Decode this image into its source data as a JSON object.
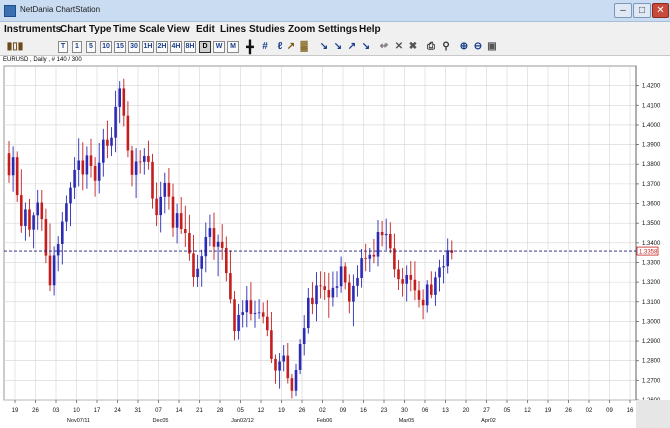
{
  "window": {
    "title": "NetDania ChartStation"
  },
  "menu": [
    "Instruments",
    "Chart Type",
    "Time Scale",
    "View",
    "Edit",
    "Lines",
    "Studies",
    "Zoom",
    "Settings",
    "Help"
  ],
  "toolbar": {
    "timeframes": [
      {
        "label": "T",
        "selected": false
      },
      {
        "label": "1",
        "selected": false
      },
      {
        "label": "5",
        "selected": false
      },
      {
        "label": "10",
        "selected": false
      },
      {
        "label": "15",
        "selected": false
      },
      {
        "label": "30",
        "selected": false
      },
      {
        "label": "1H",
        "selected": false
      },
      {
        "label": "2H",
        "selected": false
      },
      {
        "label": "4H",
        "selected": false
      },
      {
        "label": "8H",
        "selected": false
      },
      {
        "label": "D",
        "selected": true
      },
      {
        "label": "W",
        "selected": false
      },
      {
        "label": "M",
        "selected": false
      }
    ],
    "icons": [
      "crosshair-icon",
      "grid-icon",
      "fibonacci-icon",
      "volume-bars-icon",
      "line-tool-icon",
      "line-tool-icon",
      "line-tool-icon",
      "line-tool-icon",
      "line-tool-icon",
      "line-tool-icon",
      "line-tool-icon",
      "eraser-icon",
      "delete-icon",
      "delete-all-icon",
      "print-icon",
      "find-icon",
      "zoom-in-icon",
      "zoom-out-icon",
      "window-icon"
    ]
  },
  "chart": {
    "instrument_label": "EURUSD , Daily , # 140 / 300",
    "current_price_label": "1.3358",
    "colors": {
      "up": "#2b2bb5",
      "down": "#c41e1e",
      "grid": "#d4d4d4",
      "current_line": "#1a1a7a"
    }
  },
  "chart_data": {
    "type": "candlestick",
    "title": "",
    "ylim": [
      1.26,
      1.43
    ],
    "y_ticks": [
      "1.2600",
      "1.2700",
      "1.2800",
      "1.2900",
      "1.3000",
      "1.3100",
      "1.3200",
      "1.3300",
      "1.3400",
      "1.3500",
      "1.3600",
      "1.3700",
      "1.3800",
      "1.3900",
      "1.4000",
      "1.4100",
      "1.4200"
    ],
    "x_ticks": [
      "19",
      "26",
      "03",
      "10",
      "17",
      "24",
      "31",
      "07",
      "14",
      "21",
      "28",
      "05",
      "12",
      "19",
      "26",
      "02",
      "09",
      "16",
      "23",
      "30",
      "06",
      "13",
      "20",
      "27",
      "05",
      "12",
      "19",
      "26",
      "02",
      "09",
      "16"
    ],
    "x_month_labels": [
      {
        "label": "Nov07/11",
        "tick": 3
      },
      {
        "label": "Dec05",
        "tick": 7
      },
      {
        "label": "Jan02/12",
        "tick": 11
      },
      {
        "label": "Feb06",
        "tick": 15
      },
      {
        "label": "Mar05",
        "tick": 19
      },
      {
        "label": "Apr02",
        "tick": 23
      }
    ],
    "current_price": 1.3358,
    "candles": [
      [
        1.3856,
        1.3918,
        1.3705,
        1.3744
      ],
      [
        1.3744,
        1.3891,
        1.366,
        1.3836
      ],
      [
        1.3836,
        1.3865,
        1.3608,
        1.3643
      ],
      [
        1.3643,
        1.3774,
        1.3451,
        1.3486
      ],
      [
        1.3486,
        1.3605,
        1.3411,
        1.357
      ],
      [
        1.357,
        1.3624,
        1.3431,
        1.3467
      ],
      [
        1.3467,
        1.3555,
        1.3372,
        1.354
      ],
      [
        1.354,
        1.3669,
        1.3466,
        1.3605
      ],
      [
        1.3605,
        1.3669,
        1.3461,
        1.3521
      ],
      [
        1.3521,
        1.3574,
        1.3297,
        1.3335
      ],
      [
        1.3335,
        1.3498,
        1.3154,
        1.3184
      ],
      [
        1.3184,
        1.3382,
        1.3132,
        1.3336
      ],
      [
        1.3336,
        1.3434,
        1.3255,
        1.3394
      ],
      [
        1.3394,
        1.3557,
        1.329,
        1.3508
      ],
      [
        1.3508,
        1.3641,
        1.346,
        1.3601
      ],
      [
        1.3601,
        1.3709,
        1.3485,
        1.3681
      ],
      [
        1.3681,
        1.3836,
        1.3623,
        1.3771
      ],
      [
        1.3771,
        1.3932,
        1.3687,
        1.3819
      ],
      [
        1.3819,
        1.3912,
        1.3667,
        1.3748
      ],
      [
        1.3748,
        1.3891,
        1.3675,
        1.3845
      ],
      [
        1.3845,
        1.393,
        1.3732,
        1.3791
      ],
      [
        1.3791,
        1.3836,
        1.3635,
        1.3716
      ],
      [
        1.3716,
        1.3908,
        1.3651,
        1.3808
      ],
      [
        1.3808,
        1.398,
        1.3737,
        1.3925
      ],
      [
        1.3925,
        1.4022,
        1.3831,
        1.3894
      ],
      [
        1.3894,
        1.3989,
        1.3842,
        1.3935
      ],
      [
        1.3935,
        1.4174,
        1.3861,
        1.4092
      ],
      [
        1.4092,
        1.4223,
        1.4009,
        1.4186
      ],
      [
        1.4186,
        1.4235,
        1.3992,
        1.4047
      ],
      [
        1.4047,
        1.4121,
        1.3836,
        1.387
      ],
      [
        1.387,
        1.3894,
        1.3687,
        1.3746
      ],
      [
        1.3746,
        1.3882,
        1.3628,
        1.3814
      ],
      [
        1.3814,
        1.3872,
        1.3752,
        1.3812
      ],
      [
        1.3812,
        1.3882,
        1.3747,
        1.3842
      ],
      [
        1.3842,
        1.392,
        1.3772,
        1.3812
      ],
      [
        1.3812,
        1.3853,
        1.3574,
        1.3625
      ],
      [
        1.3625,
        1.3707,
        1.3485,
        1.3541
      ],
      [
        1.3541,
        1.3711,
        1.3453,
        1.3634
      ],
      [
        1.3634,
        1.3757,
        1.355,
        1.3705
      ],
      [
        1.3705,
        1.3781,
        1.3569,
        1.3635
      ],
      [
        1.3635,
        1.3701,
        1.343,
        1.3477
      ],
      [
        1.3477,
        1.3599,
        1.3397,
        1.3551
      ],
      [
        1.3551,
        1.3633,
        1.3445,
        1.347
      ],
      [
        1.347,
        1.3589,
        1.3379,
        1.345
      ],
      [
        1.345,
        1.3543,
        1.3309,
        1.3346
      ],
      [
        1.3346,
        1.344,
        1.3177,
        1.3226
      ],
      [
        1.3226,
        1.3339,
        1.3175,
        1.3268
      ],
      [
        1.3268,
        1.3365,
        1.3176,
        1.3332
      ],
      [
        1.3332,
        1.3503,
        1.325,
        1.343
      ],
      [
        1.343,
        1.3543,
        1.3383,
        1.3475
      ],
      [
        1.3475,
        1.3554,
        1.3314,
        1.338
      ],
      [
        1.338,
        1.3442,
        1.323,
        1.3405
      ],
      [
        1.3405,
        1.3495,
        1.3313,
        1.3374
      ],
      [
        1.3374,
        1.3432,
        1.3204,
        1.3246
      ],
      [
        1.3246,
        1.3362,
        1.3092,
        1.3113
      ],
      [
        1.3113,
        1.3154,
        1.2904,
        1.2951
      ],
      [
        1.2951,
        1.3089,
        1.2908,
        1.3033
      ],
      [
        1.3033,
        1.3108,
        1.2969,
        1.3047
      ],
      [
        1.3047,
        1.318,
        1.297,
        1.3108
      ],
      [
        1.3108,
        1.3199,
        1.3005,
        1.3038
      ],
      [
        1.3038,
        1.3106,
        1.2968,
        1.3043
      ],
      [
        1.3043,
        1.3113,
        1.3013,
        1.3046
      ],
      [
        1.3046,
        1.3096,
        1.299,
        1.3024
      ],
      [
        1.3024,
        1.3109,
        1.2925,
        1.2955
      ],
      [
        1.2955,
        1.3048,
        1.2788,
        1.2809
      ],
      [
        1.2809,
        1.2831,
        1.2683,
        1.275
      ],
      [
        1.275,
        1.2839,
        1.2658,
        1.2796
      ],
      [
        1.2796,
        1.288,
        1.2746,
        1.2826
      ],
      [
        1.2826,
        1.289,
        1.2684,
        1.2711
      ],
      [
        1.2711,
        1.2733,
        1.2608,
        1.2647
      ],
      [
        1.2647,
        1.2784,
        1.262,
        1.2753
      ],
      [
        1.2753,
        1.291,
        1.2732,
        1.2885
      ],
      [
        1.2885,
        1.3032,
        1.2827,
        1.2966
      ],
      [
        1.2966,
        1.317,
        1.2938,
        1.312
      ],
      [
        1.312,
        1.32,
        1.3037,
        1.3088
      ],
      [
        1.3088,
        1.3251,
        1.3001,
        1.3183
      ],
      [
        1.3183,
        1.3255,
        1.3117,
        1.3179
      ],
      [
        1.3179,
        1.3251,
        1.3109,
        1.316
      ],
      [
        1.316,
        1.3247,
        1.3018,
        1.3122
      ],
      [
        1.3122,
        1.3254,
        1.3076,
        1.3171
      ],
      [
        1.3171,
        1.3255,
        1.3123,
        1.3179
      ],
      [
        1.3179,
        1.333,
        1.3146,
        1.328
      ],
      [
        1.328,
        1.33,
        1.3163,
        1.3198
      ],
      [
        1.3198,
        1.324,
        1.3041,
        1.3101
      ],
      [
        1.3101,
        1.3239,
        1.2975,
        1.3181
      ],
      [
        1.3181,
        1.3286,
        1.3126,
        1.3221
      ],
      [
        1.3221,
        1.3369,
        1.3172,
        1.3322
      ],
      [
        1.3322,
        1.3395,
        1.3255,
        1.3319
      ],
      [
        1.3319,
        1.3374,
        1.3252,
        1.3339
      ],
      [
        1.3339,
        1.342,
        1.3296,
        1.333
      ],
      [
        1.333,
        1.3516,
        1.328,
        1.3455
      ],
      [
        1.3455,
        1.3512,
        1.3382,
        1.3439
      ],
      [
        1.3439,
        1.3523,
        1.3363,
        1.3445
      ],
      [
        1.3445,
        1.3505,
        1.3347,
        1.3372
      ],
      [
        1.3372,
        1.3447,
        1.3223,
        1.3265
      ],
      [
        1.3265,
        1.3313,
        1.316,
        1.3215
      ],
      [
        1.3215,
        1.3272,
        1.3126,
        1.3192
      ],
      [
        1.3192,
        1.3285,
        1.3102,
        1.3236
      ],
      [
        1.3236,
        1.3307,
        1.3153,
        1.3212
      ],
      [
        1.3212,
        1.3306,
        1.3108,
        1.3158
      ],
      [
        1.3158,
        1.3206,
        1.3071,
        1.311
      ],
      [
        1.311,
        1.3163,
        1.3011,
        1.3082
      ],
      [
        1.3082,
        1.321,
        1.3045,
        1.3188
      ],
      [
        1.3188,
        1.3255,
        1.3118,
        1.3135
      ],
      [
        1.3135,
        1.3253,
        1.3079,
        1.3224
      ],
      [
        1.3224,
        1.3314,
        1.3152,
        1.3275
      ],
      [
        1.3275,
        1.3338,
        1.3193,
        1.3281
      ],
      [
        1.3281,
        1.3422,
        1.3244,
        1.3362
      ],
      [
        1.3362,
        1.3412,
        1.3316,
        1.3349
      ]
    ]
  }
}
